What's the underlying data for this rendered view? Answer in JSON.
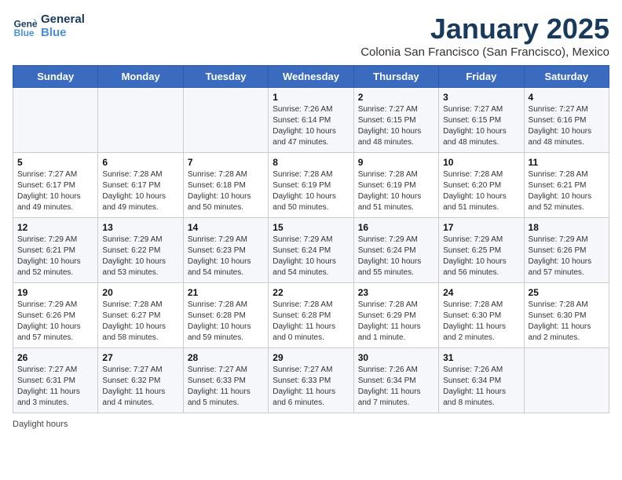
{
  "logo": {
    "line1": "General",
    "line2": "Blue"
  },
  "title": "January 2025",
  "subtitle": "Colonia San Francisco (San Francisco), Mexico",
  "days_of_week": [
    "Sunday",
    "Monday",
    "Tuesday",
    "Wednesday",
    "Thursday",
    "Friday",
    "Saturday"
  ],
  "footer_label": "Daylight hours",
  "weeks": [
    [
      {
        "day": "",
        "info": ""
      },
      {
        "day": "",
        "info": ""
      },
      {
        "day": "",
        "info": ""
      },
      {
        "day": "1",
        "info": "Sunrise: 7:26 AM\nSunset: 6:14 PM\nDaylight: 10 hours\nand 47 minutes."
      },
      {
        "day": "2",
        "info": "Sunrise: 7:27 AM\nSunset: 6:15 PM\nDaylight: 10 hours\nand 48 minutes."
      },
      {
        "day": "3",
        "info": "Sunrise: 7:27 AM\nSunset: 6:15 PM\nDaylight: 10 hours\nand 48 minutes."
      },
      {
        "day": "4",
        "info": "Sunrise: 7:27 AM\nSunset: 6:16 PM\nDaylight: 10 hours\nand 48 minutes."
      }
    ],
    [
      {
        "day": "5",
        "info": "Sunrise: 7:27 AM\nSunset: 6:17 PM\nDaylight: 10 hours\nand 49 minutes."
      },
      {
        "day": "6",
        "info": "Sunrise: 7:28 AM\nSunset: 6:17 PM\nDaylight: 10 hours\nand 49 minutes."
      },
      {
        "day": "7",
        "info": "Sunrise: 7:28 AM\nSunset: 6:18 PM\nDaylight: 10 hours\nand 50 minutes."
      },
      {
        "day": "8",
        "info": "Sunrise: 7:28 AM\nSunset: 6:19 PM\nDaylight: 10 hours\nand 50 minutes."
      },
      {
        "day": "9",
        "info": "Sunrise: 7:28 AM\nSunset: 6:19 PM\nDaylight: 10 hours\nand 51 minutes."
      },
      {
        "day": "10",
        "info": "Sunrise: 7:28 AM\nSunset: 6:20 PM\nDaylight: 10 hours\nand 51 minutes."
      },
      {
        "day": "11",
        "info": "Sunrise: 7:28 AM\nSunset: 6:21 PM\nDaylight: 10 hours\nand 52 minutes."
      }
    ],
    [
      {
        "day": "12",
        "info": "Sunrise: 7:29 AM\nSunset: 6:21 PM\nDaylight: 10 hours\nand 52 minutes."
      },
      {
        "day": "13",
        "info": "Sunrise: 7:29 AM\nSunset: 6:22 PM\nDaylight: 10 hours\nand 53 minutes."
      },
      {
        "day": "14",
        "info": "Sunrise: 7:29 AM\nSunset: 6:23 PM\nDaylight: 10 hours\nand 54 minutes."
      },
      {
        "day": "15",
        "info": "Sunrise: 7:29 AM\nSunset: 6:24 PM\nDaylight: 10 hours\nand 54 minutes."
      },
      {
        "day": "16",
        "info": "Sunrise: 7:29 AM\nSunset: 6:24 PM\nDaylight: 10 hours\nand 55 minutes."
      },
      {
        "day": "17",
        "info": "Sunrise: 7:29 AM\nSunset: 6:25 PM\nDaylight: 10 hours\nand 56 minutes."
      },
      {
        "day": "18",
        "info": "Sunrise: 7:29 AM\nSunset: 6:26 PM\nDaylight: 10 hours\nand 57 minutes."
      }
    ],
    [
      {
        "day": "19",
        "info": "Sunrise: 7:29 AM\nSunset: 6:26 PM\nDaylight: 10 hours\nand 57 minutes."
      },
      {
        "day": "20",
        "info": "Sunrise: 7:28 AM\nSunset: 6:27 PM\nDaylight: 10 hours\nand 58 minutes."
      },
      {
        "day": "21",
        "info": "Sunrise: 7:28 AM\nSunset: 6:28 PM\nDaylight: 10 hours\nand 59 minutes."
      },
      {
        "day": "22",
        "info": "Sunrise: 7:28 AM\nSunset: 6:28 PM\nDaylight: 11 hours\nand 0 minutes."
      },
      {
        "day": "23",
        "info": "Sunrise: 7:28 AM\nSunset: 6:29 PM\nDaylight: 11 hours\nand 1 minute."
      },
      {
        "day": "24",
        "info": "Sunrise: 7:28 AM\nSunset: 6:30 PM\nDaylight: 11 hours\nand 2 minutes."
      },
      {
        "day": "25",
        "info": "Sunrise: 7:28 AM\nSunset: 6:30 PM\nDaylight: 11 hours\nand 2 minutes."
      }
    ],
    [
      {
        "day": "26",
        "info": "Sunrise: 7:27 AM\nSunset: 6:31 PM\nDaylight: 11 hours\nand 3 minutes."
      },
      {
        "day": "27",
        "info": "Sunrise: 7:27 AM\nSunset: 6:32 PM\nDaylight: 11 hours\nand 4 minutes."
      },
      {
        "day": "28",
        "info": "Sunrise: 7:27 AM\nSunset: 6:33 PM\nDaylight: 11 hours\nand 5 minutes."
      },
      {
        "day": "29",
        "info": "Sunrise: 7:27 AM\nSunset: 6:33 PM\nDaylight: 11 hours\nand 6 minutes."
      },
      {
        "day": "30",
        "info": "Sunrise: 7:26 AM\nSunset: 6:34 PM\nDaylight: 11 hours\nand 7 minutes."
      },
      {
        "day": "31",
        "info": "Sunrise: 7:26 AM\nSunset: 6:34 PM\nDaylight: 11 hours\nand 8 minutes."
      },
      {
        "day": "",
        "info": ""
      }
    ]
  ]
}
